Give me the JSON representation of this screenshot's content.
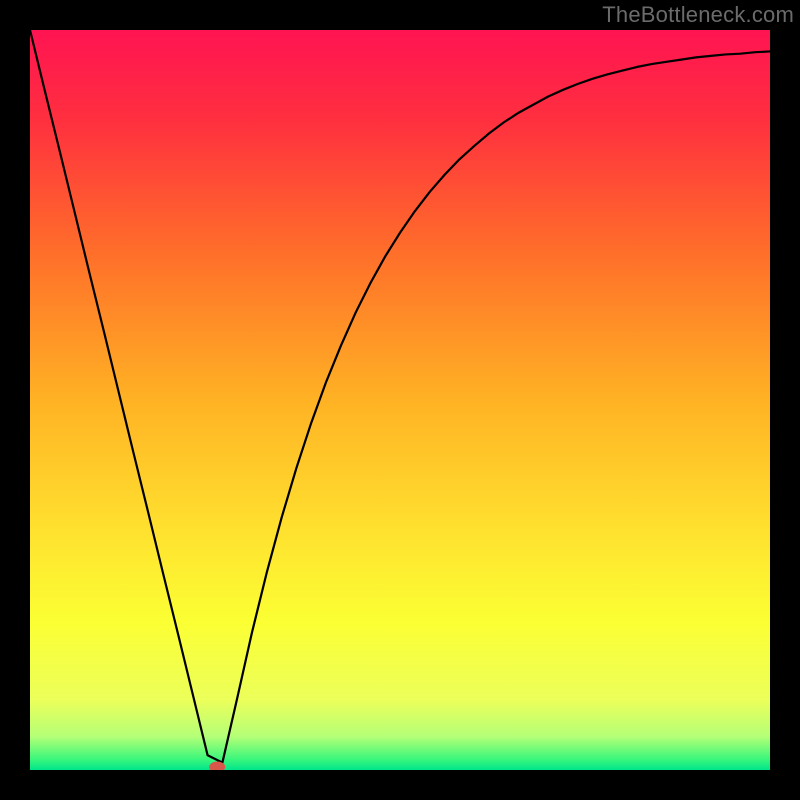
{
  "watermark": "TheBottleneck.com",
  "accent_marker_color": "#d8574a",
  "curve_color": "#000000",
  "border_color": "#000000",
  "chart_data": {
    "type": "line",
    "title": "",
    "xlabel": "",
    "ylabel": "",
    "x": [
      0.0,
      0.02,
      0.04,
      0.06,
      0.08,
      0.1,
      0.12,
      0.14,
      0.16,
      0.18,
      0.2,
      0.22,
      0.24,
      0.26,
      0.28,
      0.3,
      0.32,
      0.34,
      0.36,
      0.38,
      0.4,
      0.42,
      0.44,
      0.46,
      0.48,
      0.5,
      0.52,
      0.54,
      0.56,
      0.58,
      0.6,
      0.62,
      0.64,
      0.66,
      0.68,
      0.7,
      0.72,
      0.74,
      0.76,
      0.78,
      0.8,
      0.82,
      0.84,
      0.86,
      0.88,
      0.9,
      0.92,
      0.94,
      0.96,
      0.98,
      1.0
    ],
    "values": [
      1.0,
      0.918,
      0.837,
      0.755,
      0.673,
      0.592,
      0.51,
      0.428,
      0.347,
      0.265,
      0.184,
      0.102,
      0.02,
      0.01,
      0.097,
      0.186,
      0.267,
      0.341,
      0.408,
      0.469,
      0.524,
      0.573,
      0.618,
      0.658,
      0.694,
      0.726,
      0.755,
      0.781,
      0.804,
      0.825,
      0.843,
      0.86,
      0.875,
      0.888,
      0.899,
      0.91,
      0.919,
      0.927,
      0.934,
      0.94,
      0.945,
      0.95,
      0.954,
      0.957,
      0.96,
      0.963,
      0.965,
      0.967,
      0.968,
      0.97,
      0.971
    ],
    "xlim": [
      0,
      1
    ],
    "ylim": [
      0,
      1
    ],
    "marker": {
      "x": 0.253,
      "y": 0.004
    },
    "gradient_stops": [
      {
        "offset": 0.0,
        "color": "#ff1452"
      },
      {
        "offset": 0.12,
        "color": "#ff2f3f"
      },
      {
        "offset": 0.3,
        "color": "#ff6e2a"
      },
      {
        "offset": 0.5,
        "color": "#ffb224"
      },
      {
        "offset": 0.68,
        "color": "#ffe22f"
      },
      {
        "offset": 0.8,
        "color": "#fbff33"
      },
      {
        "offset": 0.905,
        "color": "#ecff5a"
      },
      {
        "offset": 0.955,
        "color": "#b4ff77"
      },
      {
        "offset": 0.985,
        "color": "#3cf77b"
      },
      {
        "offset": 1.0,
        "color": "#00e58b"
      }
    ]
  }
}
